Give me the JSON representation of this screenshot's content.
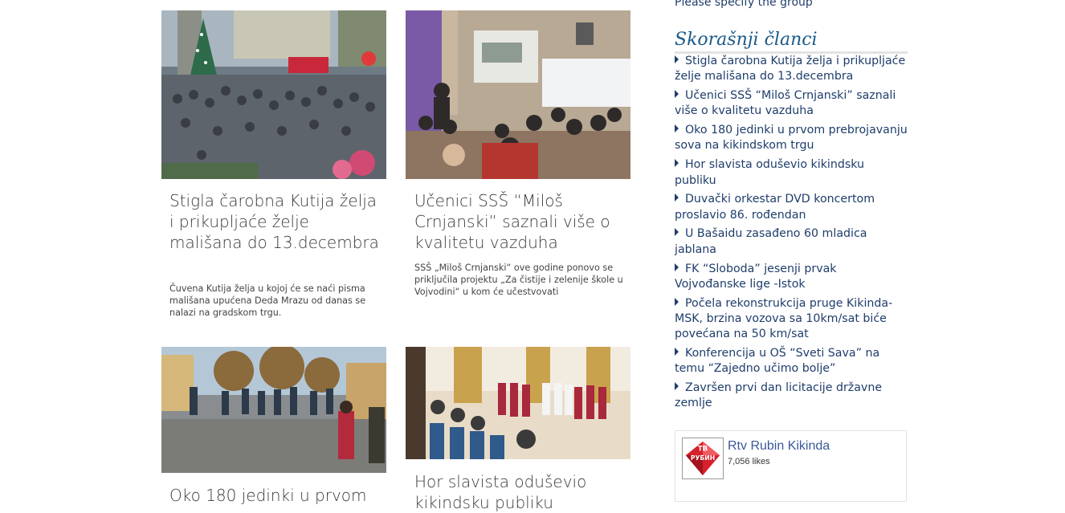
{
  "sidebar": {
    "top_text": "Please specify the group",
    "recent_heading": "Skorašnji članci",
    "recent": [
      "Stigla čarobna Kutija želja i prikupljaće želje mališana do 13.decembra",
      "Učenici SSŠ “Miloš Crnjanski” saznali više o kvalitetu vazduha",
      "Oko 180 jedinki u prvom prebrojavanju sova na kikindskom trgu",
      "Hor slavista oduševio kikindsku publiku",
      "Duvački orkestar DVD koncertom proslavio 86. rođendan",
      "U Bašaidu zasađeno 60 mladica jablana",
      "FK “Sloboda” jesenji prvak Vojvođanske lige -Istok",
      "Počela rekonstrukcija pruge Kikinda-MSK, brzina vozova sa 10km/sat biće povećana na 50 km/sat",
      "Konferencija u OŠ “Sveti Sava” na temu “Zajedno učimo bolje”",
      "Završen prvi dan licitacije državne zemlje"
    ]
  },
  "facebook": {
    "page_name": "Rtv Rubin Kikinda",
    "likes": "7,056 likes",
    "logo_text_1": "ТВ",
    "logo_text_2": "РУБИН"
  },
  "articles": [
    {
      "title": "Stigla čarobna Kutija želja i prikupljaće želje mališana do 13.decembra",
      "excerpt": "Čuvena Kutija želja u kojoj će se naći pisma mališana upućena Deda Mrazu od danas se nalazi na gradskom trgu."
    },
    {
      "title": "Učenici SSŠ “Miloš Crnjanski” saznali više o kvalitetu vazduha",
      "excerpt": "SSŠ „Miloš Crnjanski“ ove godine ponovo se priključila projektu „Za čistije i zelenije škole u Vojvodini“ u kom će učestvovati"
    },
    {
      "title": "Oko 180 jedinki u prvom",
      "excerpt": ""
    },
    {
      "title": "Hor slavista oduševio kikindsku publiku",
      "excerpt": ""
    }
  ]
}
